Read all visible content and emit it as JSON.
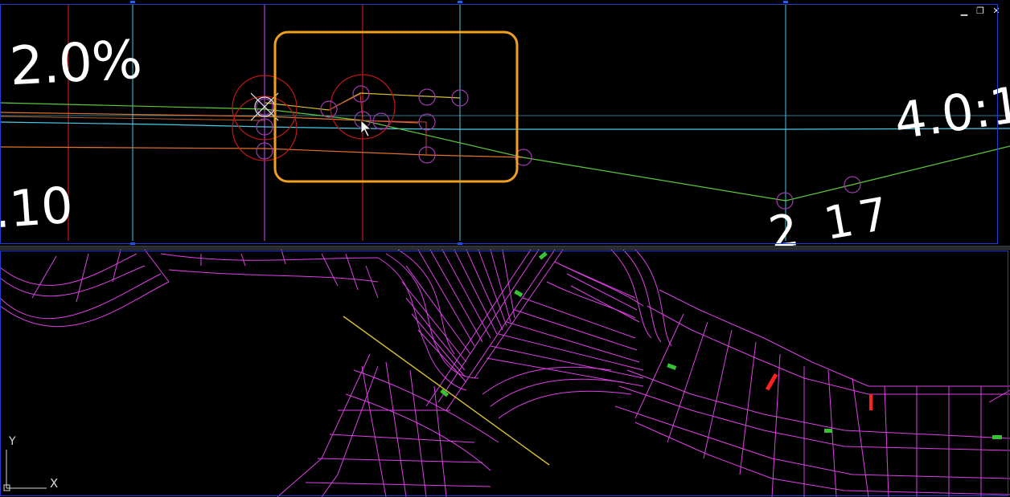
{
  "top_view": {
    "annotations": {
      "grade_percent": "2.0%",
      "slope_ratio": "4.0:1",
      "left_value": ".10",
      "bottom_value": "2 17"
    },
    "window_controls": {
      "minimize": "▁",
      "restore": "❐",
      "close": "✕"
    }
  },
  "bottom_view": {
    "ucs": {
      "x_label": "X",
      "y_label": "Y"
    }
  },
  "colors": {
    "background": "#000000",
    "viewport_border": "#1f3fd0",
    "highlight_box": "#f0a020",
    "mesh": "#e040e8",
    "alignment_green": "#5cc83a",
    "cyan_line": "#49c9e8",
    "orange_line": "#e2742a",
    "yellow_line": "#d8c030",
    "red_grid": "#c01818",
    "marker_red": "#ff2020",
    "marker_green": "#38c038"
  },
  "icons": {
    "cursor": "arrow-cursor-icon",
    "crosshair": "crosshair-pickbox-icon"
  }
}
